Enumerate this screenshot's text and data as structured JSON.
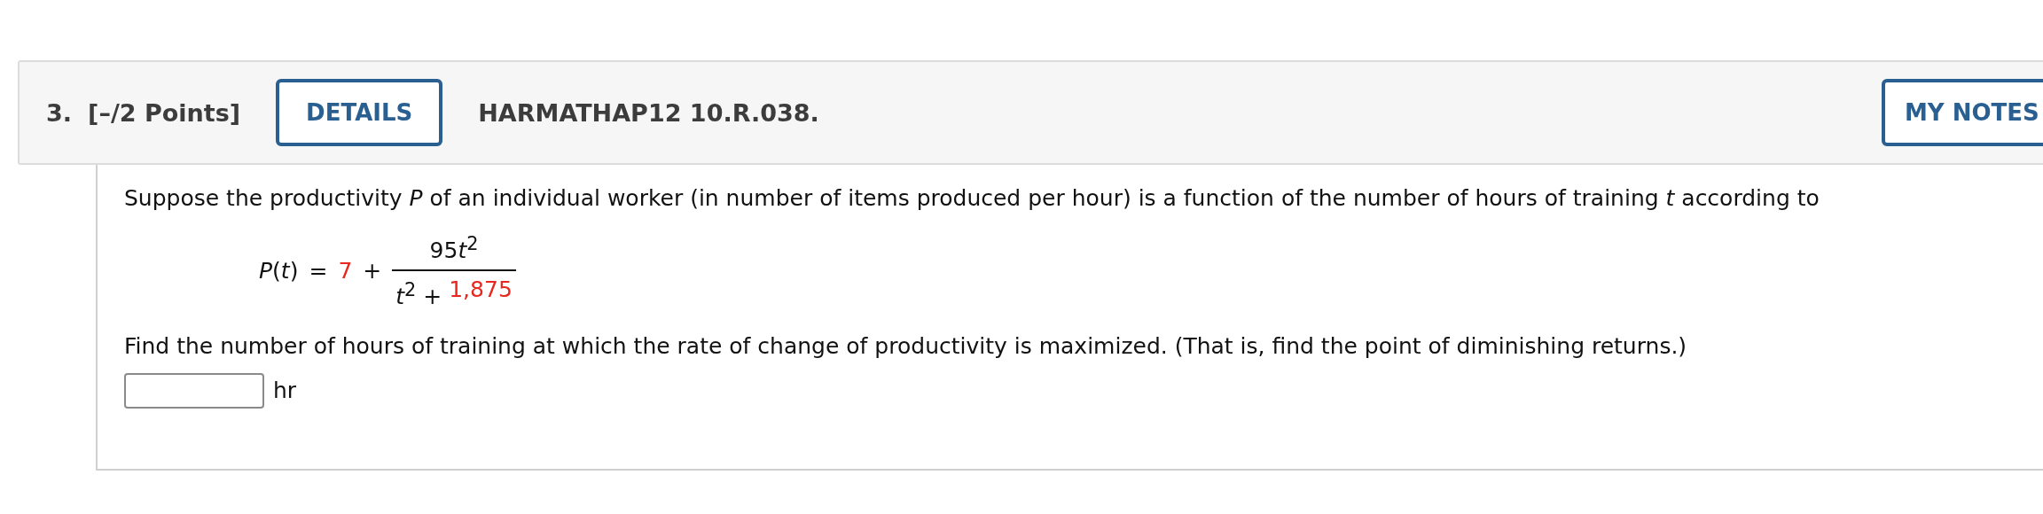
{
  "question": {
    "number": "3.",
    "points": "[–/2 Points]",
    "details_button": "DETAILS",
    "code": "HARMATHAP12 10.R.038.",
    "notes_button": "MY NOTES"
  },
  "body": {
    "intro": "Suppose the productivity *P* of an individual worker (in number of items produced per hour) is a function of the number of hours of training *t* according to",
    "formula": {
      "lhs": "*P*(*t*)",
      "equals": "=",
      "constant": "7",
      "plus": "+",
      "numerator_coefficient": "95",
      "numerator_term": "*t*$^{2}$",
      "denominator_term": "*t*$^{2}$ +",
      "denominator_constant": "1,875"
    },
    "prompt": "Find the number of hours of training at which the rate of change of productivity is maximized. (That is, find the point of diminishing returns.)",
    "answer": {
      "unit": "hr"
    }
  }
}
